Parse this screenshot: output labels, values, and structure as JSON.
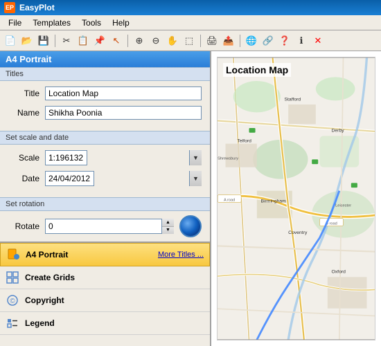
{
  "app": {
    "title": "EasyPlot",
    "icon_label": "EP"
  },
  "menu": {
    "items": [
      "File",
      "Templates",
      "Tools",
      "Help"
    ]
  },
  "toolbar": {
    "buttons": [
      {
        "name": "new-icon",
        "symbol": "📄"
      },
      {
        "name": "open-icon",
        "symbol": "📂"
      },
      {
        "name": "save-icon",
        "symbol": "💾"
      },
      {
        "name": "cut-icon",
        "symbol": "✂"
      },
      {
        "name": "copy-icon",
        "symbol": "📋"
      },
      {
        "name": "paste-icon",
        "symbol": "📌"
      },
      {
        "name": "cursor-icon",
        "symbol": "↖"
      },
      {
        "name": "zoom-in-icon",
        "symbol": "🔍"
      },
      {
        "name": "zoom-out-icon",
        "symbol": "🔎"
      },
      {
        "name": "pan-icon",
        "symbol": "✋"
      },
      {
        "name": "select-icon",
        "symbol": "⬚"
      },
      {
        "name": "print-icon",
        "symbol": "🖨"
      },
      {
        "name": "export-icon",
        "symbol": "📤"
      },
      {
        "name": "globe-toolbar-icon",
        "symbol": "🌐"
      },
      {
        "name": "help-icon",
        "symbol": "❓"
      },
      {
        "name": "close-icon",
        "symbol": "✕"
      }
    ]
  },
  "left_panel": {
    "header": "A4 Portrait",
    "sections": {
      "titles": "Titles",
      "scale_date": "Set scale and date",
      "rotation": "Set rotation"
    },
    "fields": {
      "title_label": "Title",
      "title_value": "Location Map",
      "name_label": "Name",
      "name_value": "Shikha Poonia",
      "scale_label": "Scale",
      "scale_value": "1:196132",
      "date_label": "Date",
      "date_value": "24/04/2012",
      "rotate_label": "Rotate",
      "rotate_value": "0"
    }
  },
  "bottom_list": {
    "items": [
      {
        "id": "a4-portrait",
        "label": "A4 Portrait",
        "icon": "portrait",
        "active": true
      },
      {
        "id": "create-grids",
        "label": "Create Grids",
        "icon": "grid",
        "active": false
      },
      {
        "id": "copyright",
        "label": "Copyright",
        "icon": "copyright",
        "active": false
      },
      {
        "id": "legend",
        "label": "Legend",
        "icon": "legend",
        "active": false
      }
    ],
    "more_titles_label": "More Titles ..."
  },
  "map": {
    "title": "Location Map"
  },
  "colors": {
    "accent_blue": "#2a7ed8",
    "active_yellow": "#fde080"
  }
}
